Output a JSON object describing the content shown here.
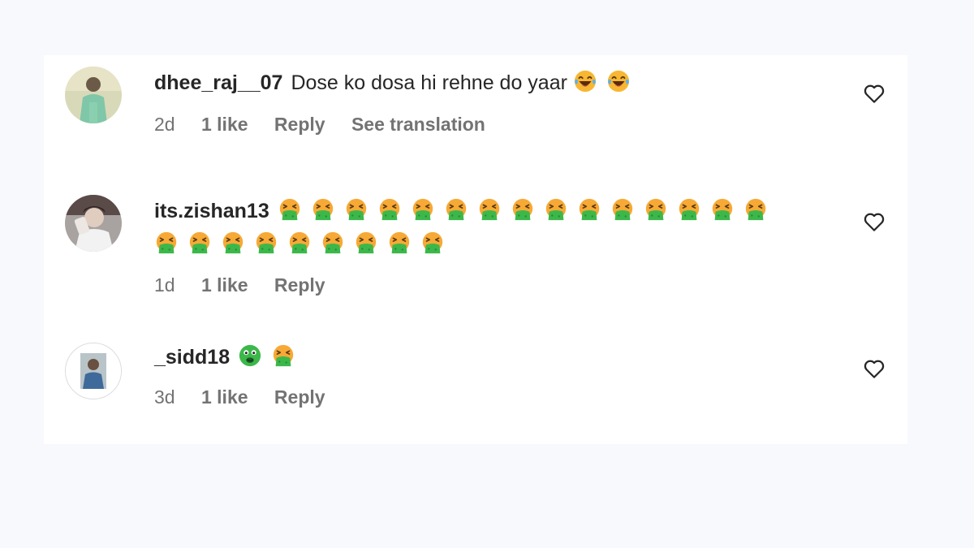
{
  "comments": [
    {
      "username": "dhee_raj__07",
      "text": "Dose ko dosa hi rehne do yaar",
      "emojis": [
        "laughing-tears",
        "laughing-tears"
      ],
      "time": "2d",
      "likes": "1 like",
      "reply_label": "Reply",
      "translation_label": "See translation"
    },
    {
      "username": "its.zishan13",
      "text": "",
      "emojis": [
        "vomiting",
        "vomiting",
        "vomiting",
        "vomiting",
        "vomiting",
        "vomiting",
        "vomiting",
        "vomiting",
        "vomiting",
        "vomiting",
        "vomiting",
        "vomiting",
        "vomiting",
        "vomiting",
        "vomiting",
        "vomiting",
        "vomiting",
        "vomiting",
        "vomiting",
        "vomiting",
        "vomiting",
        "vomiting",
        "vomiting",
        "vomiting"
      ],
      "time": "1d",
      "likes": "1 like",
      "reply_label": "Reply"
    },
    {
      "username": "_sidd18",
      "text": "",
      "emojis": [
        "nauseated",
        "vomiting"
      ],
      "time": "3d",
      "likes": "1 like",
      "reply_label": "Reply"
    }
  ],
  "icons": {
    "heart": "heart-outline-icon"
  },
  "colors": {
    "secondary_text": "#737373",
    "primary_text": "#262626"
  }
}
